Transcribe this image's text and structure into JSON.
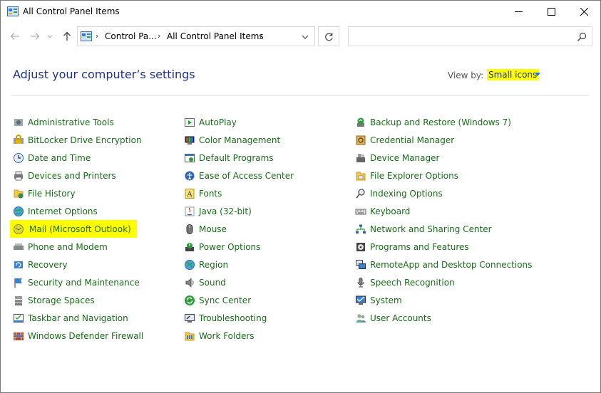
{
  "window": {
    "title": "All Control Panel Items",
    "min_label": "Minimize",
    "max_label": "Maximize",
    "close_label": "Close"
  },
  "nav": {
    "breadcrumb": [
      "Control Pa...",
      "All Control Panel Items"
    ],
    "search_placeholder": ""
  },
  "header": {
    "title": "Adjust your computer’s settings",
    "view_by_label": "View by:",
    "view_by_value": "Small icons"
  },
  "colors": {
    "title_blue": "#1e3287",
    "link_green": "#1a6b1a",
    "highlight": "#ffff00"
  },
  "items": {
    "col1": [
      {
        "label": "Administrative Tools",
        "icon": "admin-tools-icon"
      },
      {
        "label": "BitLocker Drive Encryption",
        "icon": "bitlocker-icon"
      },
      {
        "label": "Date and Time",
        "icon": "clock-icon"
      },
      {
        "label": "Devices and Printers",
        "icon": "printer-icon"
      },
      {
        "label": "File History",
        "icon": "file-history-icon"
      },
      {
        "label": "Internet Options",
        "icon": "globe-icon"
      },
      {
        "label": "Mail (Microsoft Outlook)",
        "icon": "mail-icon",
        "highlighted": true
      },
      {
        "label": "Phone and Modem",
        "icon": "modem-icon"
      },
      {
        "label": "Recovery",
        "icon": "recovery-icon"
      },
      {
        "label": "Security and Maintenance",
        "icon": "flag-icon"
      },
      {
        "label": "Storage Spaces",
        "icon": "storage-icon"
      },
      {
        "label": "Taskbar and Navigation",
        "icon": "taskbar-icon"
      },
      {
        "label": "Windows Defender Firewall",
        "icon": "firewall-icon"
      }
    ],
    "col2": [
      {
        "label": "AutoPlay",
        "icon": "autoplay-icon"
      },
      {
        "label": "Color Management",
        "icon": "color-management-icon"
      },
      {
        "label": "Default Programs",
        "icon": "default-programs-icon"
      },
      {
        "label": "Ease of Access Center",
        "icon": "ease-of-access-icon"
      },
      {
        "label": "Fonts",
        "icon": "fonts-icon"
      },
      {
        "label": "Java (32-bit)",
        "icon": "java-icon"
      },
      {
        "label": "Mouse",
        "icon": "mouse-icon"
      },
      {
        "label": "Power Options",
        "icon": "power-icon"
      },
      {
        "label": "Region",
        "icon": "region-icon"
      },
      {
        "label": "Sound",
        "icon": "speaker-icon"
      },
      {
        "label": "Sync Center",
        "icon": "sync-icon"
      },
      {
        "label": "Troubleshooting",
        "icon": "troubleshooting-icon"
      },
      {
        "label": "Work Folders",
        "icon": "work-folders-icon"
      }
    ],
    "col3": [
      {
        "label": "Backup and Restore (Windows 7)",
        "icon": "backup-icon"
      },
      {
        "label": "Credential Manager",
        "icon": "credential-icon"
      },
      {
        "label": "Device Manager",
        "icon": "device-manager-icon"
      },
      {
        "label": "File Explorer Options",
        "icon": "folder-options-icon"
      },
      {
        "label": "Indexing Options",
        "icon": "indexing-icon"
      },
      {
        "label": "Keyboard",
        "icon": "keyboard-icon"
      },
      {
        "label": "Network and Sharing Center",
        "icon": "network-icon"
      },
      {
        "label": "Programs and Features",
        "icon": "programs-icon"
      },
      {
        "label": "RemoteApp and Desktop Connections",
        "icon": "remoteapp-icon"
      },
      {
        "label": "Speech Recognition",
        "icon": "microphone-icon"
      },
      {
        "label": "System",
        "icon": "system-icon"
      },
      {
        "label": "User Accounts",
        "icon": "users-icon"
      }
    ]
  }
}
